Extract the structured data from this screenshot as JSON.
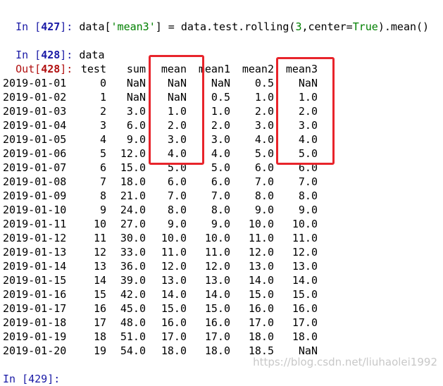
{
  "cell1": {
    "prompt": "In [",
    "num": "427",
    "prompt_end": "]: ",
    "code_a": "data[",
    "code_str": "'mean3'",
    "code_b": "] = data.test.rolling(",
    "code_num": "3",
    "code_c": ",center=",
    "code_kw": "True",
    "code_d": ").mean()"
  },
  "cell2": {
    "prompt": "In [",
    "num": "428",
    "prompt_end": "]: ",
    "code": "data"
  },
  "out": {
    "prompt": "Out[",
    "num": "428",
    "prompt_end": "]:"
  },
  "table": {
    "columns": [
      "test",
      "sum",
      "mean",
      "mean1",
      "mean2",
      "mean3"
    ],
    "rows": [
      [
        "2019-01-01",
        "0",
        "NaN",
        "NaN",
        "NaN",
        "0.5",
        "NaN"
      ],
      [
        "2019-01-02",
        "1",
        "NaN",
        "NaN",
        "0.5",
        "1.0",
        "1.0"
      ],
      [
        "2019-01-03",
        "2",
        "3.0",
        "1.0",
        "1.0",
        "2.0",
        "2.0"
      ],
      [
        "2019-01-04",
        "3",
        "6.0",
        "2.0",
        "2.0",
        "3.0",
        "3.0"
      ],
      [
        "2019-01-05",
        "4",
        "9.0",
        "3.0",
        "3.0",
        "4.0",
        "4.0"
      ],
      [
        "2019-01-06",
        "5",
        "12.0",
        "4.0",
        "4.0",
        "5.0",
        "5.0"
      ],
      [
        "2019-01-07",
        "6",
        "15.0",
        "5.0",
        "5.0",
        "6.0",
        "6.0"
      ],
      [
        "2019-01-08",
        "7",
        "18.0",
        "6.0",
        "6.0",
        "7.0",
        "7.0"
      ],
      [
        "2019-01-09",
        "8",
        "21.0",
        "7.0",
        "7.0",
        "8.0",
        "8.0"
      ],
      [
        "2019-01-10",
        "9",
        "24.0",
        "8.0",
        "8.0",
        "9.0",
        "9.0"
      ],
      [
        "2019-01-11",
        "10",
        "27.0",
        "9.0",
        "9.0",
        "10.0",
        "10.0"
      ],
      [
        "2019-01-12",
        "11",
        "30.0",
        "10.0",
        "10.0",
        "11.0",
        "11.0"
      ],
      [
        "2019-01-13",
        "12",
        "33.0",
        "11.0",
        "11.0",
        "12.0",
        "12.0"
      ],
      [
        "2019-01-14",
        "13",
        "36.0",
        "12.0",
        "12.0",
        "13.0",
        "13.0"
      ],
      [
        "2019-01-15",
        "14",
        "39.0",
        "13.0",
        "13.0",
        "14.0",
        "14.0"
      ],
      [
        "2019-01-16",
        "15",
        "42.0",
        "14.0",
        "14.0",
        "15.0",
        "15.0"
      ],
      [
        "2019-01-17",
        "16",
        "45.0",
        "15.0",
        "15.0",
        "16.0",
        "16.0"
      ],
      [
        "2019-01-18",
        "17",
        "48.0",
        "16.0",
        "16.0",
        "17.0",
        "17.0"
      ],
      [
        "2019-01-19",
        "18",
        "51.0",
        "17.0",
        "17.0",
        "18.0",
        "18.0"
      ],
      [
        "2019-01-20",
        "19",
        "54.0",
        "18.0",
        "18.0",
        "18.5",
        "NaN"
      ]
    ]
  },
  "next_prompt": "In [429]:",
  "watermark": "https://blog.csdn.net/liuhaolei1992",
  "colors": {
    "highlight_box": "#e8242b",
    "in_prompt": "#1a1aa6",
    "out_prompt": "#b11010",
    "string": "#008000"
  }
}
